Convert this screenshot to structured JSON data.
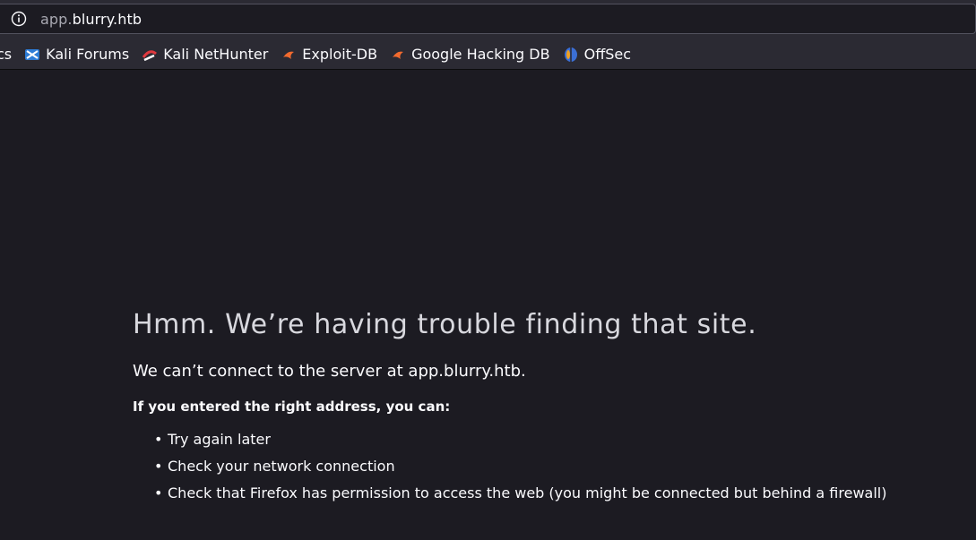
{
  "address_bar": {
    "url_subdomain": "app.",
    "url_host": "blurry.htb",
    "info_icon": "info-circle-icon"
  },
  "bookmarks": [
    {
      "label": "cs",
      "icon": null
    },
    {
      "label": "Kali Forums",
      "icon": "kali-forums-icon"
    },
    {
      "label": "Kali NetHunter",
      "icon": "kali-nethunter-icon"
    },
    {
      "label": "Exploit-DB",
      "icon": "exploit-db-icon"
    },
    {
      "label": "Google Hacking DB",
      "icon": "google-hacking-db-icon"
    },
    {
      "label": "OffSec",
      "icon": "offsec-icon"
    }
  ],
  "error": {
    "title": "Hmm. We’re having trouble finding that site.",
    "description": "We can’t connect to the server at app.blurry.htb.",
    "hint": "If you entered the right address, you can:",
    "tips": [
      "Try again later",
      "Check your network connection",
      "Check that Firefox has permission to access the web (you might be connected but behind a firewall)"
    ]
  },
  "colors": {
    "page_bg": "#1c1b22",
    "toolbar_bg": "#2b2a33",
    "text": "#fbfbfe",
    "dim_text": "#a9a9b2"
  }
}
